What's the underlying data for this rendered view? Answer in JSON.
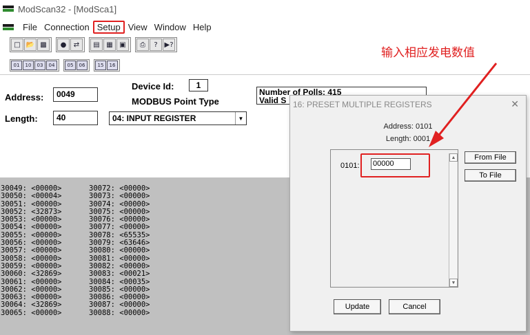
{
  "window": {
    "title": "ModScan32 - [ModSca1]"
  },
  "menu": [
    "File",
    "Connection",
    "Setup",
    "View",
    "Window",
    "Help"
  ],
  "annotation": "输入相应发电数值",
  "form": {
    "address_label": "Address:",
    "address_value": "0049",
    "length_label": "Length:",
    "length_value": "40",
    "device_id_label": "Device Id:",
    "device_id_value": "1",
    "point_type_label": "MODBUS Point Type",
    "point_type_value": "04: INPUT REGISTER",
    "polls_line1": "Number of Polls: 415",
    "polls_line2": "Valid S"
  },
  "registers_col1": [
    "30049: <00000>",
    "30050: <00004>",
    "30051: <00000>",
    "30052: <32873>",
    "30053: <00000>",
    "30054: <00000>",
    "30055: <00000>",
    "30056: <00000>",
    "30057: <00000>",
    "30058: <00000>",
    "30059: <00000>",
    "30060: <32869>",
    "30061: <00000>",
    "30062: <00000>",
    "30063: <00000>",
    "30064: <32869>",
    "30065: <00000>"
  ],
  "registers_col2": [
    "30072: <00000>",
    "30073: <00000>",
    "30074: <00000>",
    "30075: <00000>",
    "30076: <00000>",
    "30077: <00000>",
    "30078: <65535>",
    "30079: <63646>",
    "30080: <00000>",
    "30081: <00000>",
    "30082: <00000>",
    "30083: <00021>",
    "30084: <00035>",
    "30085: <00000>",
    "30086: <00000>",
    "30087: <00000>",
    "30088: <00000>"
  ],
  "dialog": {
    "title": "16: PRESET MULTIPLE REGISTERS",
    "address": "Address: 0101",
    "length": "Length: 0001",
    "register_label": "0101:",
    "register_value": "00000",
    "from_file": "From File",
    "to_file": "To File",
    "update": "Update",
    "cancel": "Cancel"
  }
}
